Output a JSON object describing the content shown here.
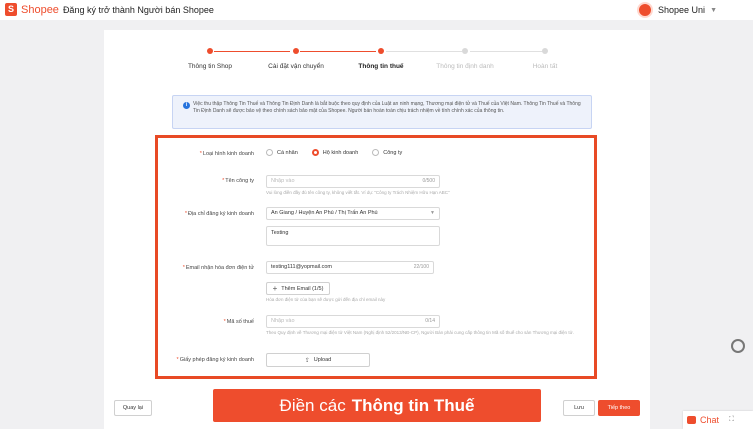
{
  "header": {
    "logo_text": "Shopee",
    "title": "Đăng ký trở thành Người bán Shopee",
    "user_label": "Shopee Uni"
  },
  "steps": [
    {
      "label": "Thông tin Shop",
      "state": "done"
    },
    {
      "label": "Cài đặt vận chuyển",
      "state": "done"
    },
    {
      "label": "Thông tin thuế",
      "state": "active"
    },
    {
      "label": "Thông tin định danh",
      "state": "pending"
    },
    {
      "label": "Hoàn tất",
      "state": "pending"
    }
  ],
  "info_notice": "Việc thu thập Thông Tin Thuế và Thông Tin Định Danh là bắt buộc theo quy định của Luật an ninh mạng, Thương mại điện tử và Thuế của Việt Nam. Thông Tin Thuế và Thông Tin Định Danh sẽ được bảo vệ theo chính sách bảo mật của Shopee. Người bán hoàn toàn chịu trách nhiệm về tính chính xác của thông tin.",
  "form": {
    "business_type": {
      "label": "Loại hình kinh doanh",
      "options": [
        "Cá nhân",
        "Hộ kinh doanh",
        "Công ty"
      ],
      "selected": "Hộ kinh doanh"
    },
    "company_name": {
      "label": "Tên công ty",
      "placeholder": "Nhập vào",
      "counter": "0/500",
      "hint": "Vui lòng điền đầy đủ tên công ty, không viết tắt. Ví dụ: \"Công ty Trách Nhiệm Hữu Hạn ABC\""
    },
    "address": {
      "label": "Địa chỉ đăng ký kinh doanh",
      "region": "An Giang / Huyện An Phú / Thị Trấn An Phú",
      "detail": "Testing"
    },
    "email": {
      "label": "Email nhận hóa đơn điện tử",
      "value": "testing111@yopmail.com",
      "counter": "22/100",
      "add_button": "Thêm Email (1/5)",
      "hint": "Hóa đơn điện tử của bạn sẽ được gửi đến địa chỉ email này"
    },
    "tax_code": {
      "label": "Mã số thuế",
      "placeholder": "Nhập vào",
      "counter": "0/14",
      "hint": "Theo Quy định về Thương mại điện tử Việt Nam (Nghị định 52/2013/NĐ-CP), Người Bán phải cung cấp thông tin Mã số thuế cho sàn Thương mại điện tử."
    },
    "license": {
      "label": "Giấy phép đăng ký kinh doanh",
      "upload_label": "Upload"
    }
  },
  "footer": {
    "back": "Quay lại",
    "save": "Lưu",
    "next": "Tiếp theo"
  },
  "banner": {
    "prefix": "Điền các",
    "emphasis": "Thông tin Thuế"
  },
  "chat": {
    "label": "Chat"
  },
  "colors": {
    "brand": "#ee4d2d",
    "frame": "#e84a25",
    "info_bg": "#eef2fb"
  }
}
